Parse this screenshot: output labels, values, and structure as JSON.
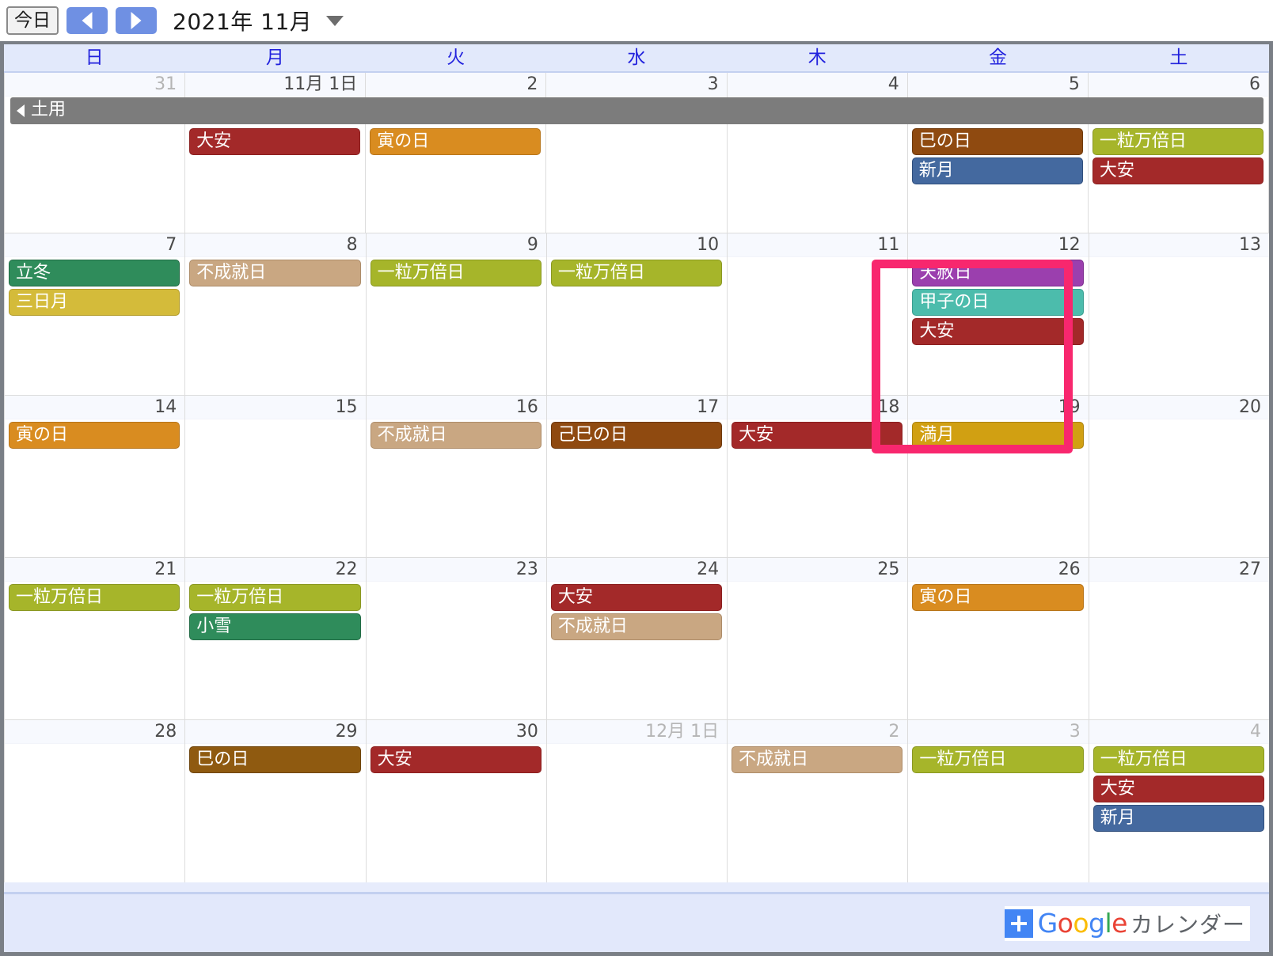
{
  "toolbar": {
    "today_label": "今日",
    "prev_label": "前月",
    "next_label": "翌月",
    "title": "2021年 11月",
    "dropdown_label": "表示切替"
  },
  "weekdays": [
    {
      "label": "日"
    },
    {
      "label": "月"
    },
    {
      "label": "火"
    },
    {
      "label": "水"
    },
    {
      "label": "木"
    },
    {
      "label": "金"
    },
    {
      "label": "土"
    }
  ],
  "banner": {
    "label": "土用",
    "color": "#7c7c7c",
    "continues_from_previous": true
  },
  "highlight": {
    "color": "#f8276e",
    "target_day": "12"
  },
  "colors": {
    "taian": "#a32929",
    "tora": "#d38017",
    "mi": "#8c4a10",
    "shingetsu": "#41699e",
    "ichiryu": "#a3b224",
    "rittou": "#2e8b57",
    "mikazuki": "#d6b game"
  },
  "weeks": [
    {
      "days": [
        {
          "num": "31",
          "other_month": true,
          "events": []
        },
        {
          "num": "11月 1日",
          "other_month": false,
          "events": [
            {
              "label": "大安",
              "color": "#a32929",
              "border": "#8b1f1f",
              "text": "#ffffff"
            }
          ]
        },
        {
          "num": "2",
          "other_month": false,
          "events": [
            {
              "label": "寅の日",
              "color": "#d98c20",
              "border": "#b8751a",
              "text": "#ffffff"
            }
          ]
        },
        {
          "num": "3",
          "other_month": false,
          "events": []
        },
        {
          "num": "4",
          "other_month": false,
          "events": []
        },
        {
          "num": "5",
          "other_month": false,
          "events": [
            {
              "label": "巳の日",
              "color": "#8f4a10",
              "border": "#6e390c",
              "text": "#ffffff"
            },
            {
              "label": "新月",
              "color": "#44699f",
              "border": "#2f4e7c",
              "text": "#ffffff"
            }
          ]
        },
        {
          "num": "6",
          "other_month": false,
          "events": [
            {
              "label": "一粒万倍日",
              "color": "#a6b52a",
              "border": "#8a9822",
              "text": "#ffffff"
            },
            {
              "label": "大安",
              "color": "#a32929",
              "border": "#8b1f1f",
              "text": "#ffffff"
            }
          ]
        }
      ]
    },
    {
      "days": [
        {
          "num": "7",
          "other_month": false,
          "events": [
            {
              "label": "立冬",
              "color": "#2f8c5b",
              "border": "#226b45",
              "text": "#ffffff"
            },
            {
              "label": "三日月",
              "color": "#d4bb3a",
              "border": "#b39c2c",
              "text": "#ffffff"
            }
          ]
        },
        {
          "num": "8",
          "other_month": false,
          "events": [
            {
              "label": "不成就日",
              "color": "#c9a782",
              "border": "#ad8c69",
              "text": "#ffffff"
            }
          ]
        },
        {
          "num": "9",
          "other_month": false,
          "events": [
            {
              "label": "一粒万倍日",
              "color": "#a6b52a",
              "border": "#8a9822",
              "text": "#ffffff"
            }
          ]
        },
        {
          "num": "10",
          "other_month": false,
          "events": [
            {
              "label": "一粒万倍日",
              "color": "#a6b52a",
              "border": "#8a9822",
              "text": "#ffffff"
            }
          ]
        },
        {
          "num": "11",
          "other_month": false,
          "events": []
        },
        {
          "num": "12",
          "other_month": false,
          "events": [
            {
              "label": "天赦日",
              "color": "#9b3fae",
              "border": "#7d2e8e",
              "text": "#ffffff"
            },
            {
              "label": "甲子の日",
              "color": "#4cbcac",
              "border": "#3a9e90",
              "text": "#ffffff"
            },
            {
              "label": "大安",
              "color": "#a32929",
              "border": "#8b1f1f",
              "text": "#ffffff"
            }
          ]
        },
        {
          "num": "13",
          "other_month": false,
          "events": []
        }
      ]
    },
    {
      "days": [
        {
          "num": "14",
          "other_month": false,
          "events": [
            {
              "label": "寅の日",
              "color": "#d98c20",
              "border": "#b8751a",
              "text": "#ffffff"
            }
          ]
        },
        {
          "num": "15",
          "other_month": false,
          "events": []
        },
        {
          "num": "16",
          "other_month": false,
          "events": [
            {
              "label": "不成就日",
              "color": "#c9a782",
              "border": "#ad8c69",
              "text": "#ffffff"
            }
          ]
        },
        {
          "num": "17",
          "other_month": false,
          "events": [
            {
              "label": "己巳の日",
              "color": "#8f4a10",
              "border": "#6e390c",
              "text": "#ffffff"
            }
          ]
        },
        {
          "num": "18",
          "other_month": false,
          "events": [
            {
              "label": "大安",
              "color": "#a32929",
              "border": "#8b1f1f",
              "text": "#ffffff"
            }
          ]
        },
        {
          "num": "19",
          "other_month": false,
          "events": [
            {
              "label": "満月",
              "color": "#d1a012",
              "border": "#ad830d",
              "text": "#ffffff"
            }
          ]
        },
        {
          "num": "20",
          "other_month": false,
          "events": []
        }
      ]
    },
    {
      "days": [
        {
          "num": "21",
          "other_month": false,
          "events": [
            {
              "label": "一粒万倍日",
              "color": "#a6b52a",
              "border": "#8a9822",
              "text": "#ffffff"
            }
          ]
        },
        {
          "num": "22",
          "other_month": false,
          "events": [
            {
              "label": "一粒万倍日",
              "color": "#a6b52a",
              "border": "#8a9822",
              "text": "#ffffff"
            },
            {
              "label": "小雪",
              "color": "#2f8c5b",
              "border": "#226b45",
              "text": "#ffffff"
            }
          ]
        },
        {
          "num": "23",
          "other_month": false,
          "events": []
        },
        {
          "num": "24",
          "other_month": false,
          "events": [
            {
              "label": "大安",
              "color": "#a32929",
              "border": "#8b1f1f",
              "text": "#ffffff"
            },
            {
              "label": "不成就日",
              "color": "#c9a782",
              "border": "#ad8c69",
              "text": "#ffffff"
            }
          ]
        },
        {
          "num": "25",
          "other_month": false,
          "events": []
        },
        {
          "num": "26",
          "other_month": false,
          "events": [
            {
              "label": "寅の日",
              "color": "#d98c20",
              "border": "#b8751a",
              "text": "#ffffff"
            }
          ]
        },
        {
          "num": "27",
          "other_month": false,
          "events": []
        }
      ]
    },
    {
      "days": [
        {
          "num": "28",
          "other_month": false,
          "events": []
        },
        {
          "num": "29",
          "other_month": false,
          "events": [
            {
              "label": "巳の日",
              "color": "#8f5a10",
              "border": "#6e440c",
              "text": "#ffffff"
            }
          ]
        },
        {
          "num": "30",
          "other_month": false,
          "events": [
            {
              "label": "大安",
              "color": "#a32929",
              "border": "#8b1f1f",
              "text": "#ffffff"
            }
          ]
        },
        {
          "num": "12月 1日",
          "other_month": true,
          "events": []
        },
        {
          "num": "2",
          "other_month": true,
          "events": [
            {
              "label": "不成就日",
              "color": "#c9a782",
              "border": "#ad8c69",
              "text": "#ffffff"
            }
          ]
        },
        {
          "num": "3",
          "other_month": true,
          "events": [
            {
              "label": "一粒万倍日",
              "color": "#a6b52a",
              "border": "#8a9822",
              "text": "#ffffff"
            }
          ]
        },
        {
          "num": "4",
          "other_month": true,
          "events": [
            {
              "label": "一粒万倍日",
              "color": "#a6b52a",
              "border": "#8a9822",
              "text": "#ffffff"
            },
            {
              "label": "大安",
              "color": "#a32929",
              "border": "#8b1f1f",
              "text": "#ffffff"
            },
            {
              "label": "新月",
              "color": "#44699f",
              "border": "#2f4e7c",
              "text": "#ffffff"
            }
          ]
        }
      ]
    }
  ],
  "footer": {
    "google_letters": [
      {
        "ch": "G",
        "color": "#4285f4"
      },
      {
        "ch": "o",
        "color": "#ea4335"
      },
      {
        "ch": "o",
        "color": "#fbbc05"
      },
      {
        "ch": "g",
        "color": "#4285f4"
      },
      {
        "ch": "l",
        "color": "#34a853"
      },
      {
        "ch": "e",
        "color": "#ea4335"
      }
    ],
    "suffix": "カレンダー",
    "plus_color": "#4285f4"
  }
}
